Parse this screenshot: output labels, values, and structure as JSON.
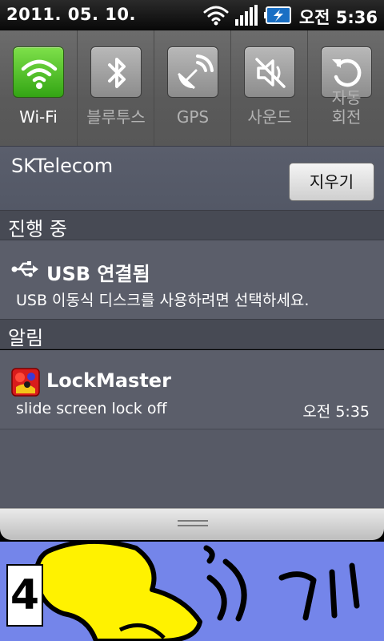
{
  "status_bar": {
    "date": "2011. 05. 10.",
    "time": "오전 5:36"
  },
  "toggles": [
    {
      "label": "Wi-Fi",
      "icon": "wifi-icon",
      "on": true
    },
    {
      "label": "블루투스",
      "icon": "bluetooth-icon",
      "on": false
    },
    {
      "label": "GPS",
      "icon": "gps-icon",
      "on": false
    },
    {
      "label": "사운드",
      "icon": "sound-muted-icon",
      "on": false
    },
    {
      "label_line1": "자동",
      "label_line2": "회전",
      "icon": "auto-rotate-icon",
      "on": false
    }
  ],
  "carrier": {
    "name": "SKTelecom",
    "clear_label": "지우기"
  },
  "ongoing": {
    "header": "진행 중",
    "items": [
      {
        "title": "USB 연결됨",
        "text": "USB 이동식 디스크를 사용하려면 선택하세요.",
        "icon": "usb-icon"
      }
    ]
  },
  "notifications": {
    "header": "알림",
    "items": [
      {
        "title": "LockMaster",
        "text": "slide screen lock off",
        "time": "오전 5:35",
        "icon": "lockmaster-app-icon"
      }
    ]
  },
  "wallpaper": {
    "page_number": "4"
  },
  "colors": {
    "wifi_on": "#3fb51c",
    "panel": "#5b5e6a",
    "section_header": "#474a54",
    "wallpaper": "#7485ea"
  }
}
